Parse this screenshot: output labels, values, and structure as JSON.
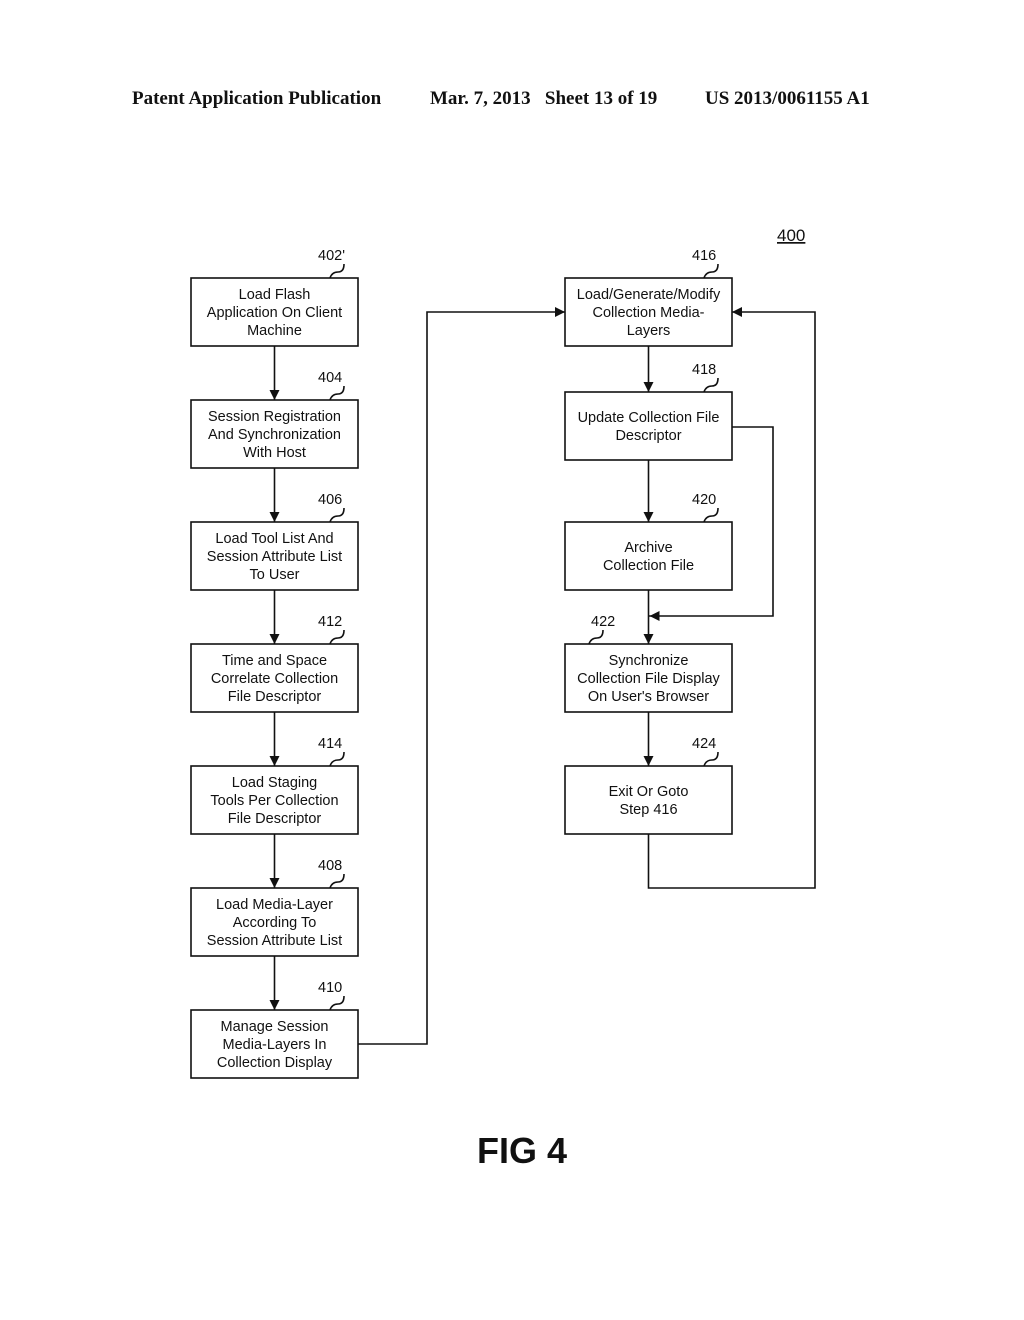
{
  "header": {
    "publication": "Patent Application Publication",
    "date_sheet": "Mar. 7, 2013   Sheet 13 of 19",
    "patent_number": "US 2013/0061155 A1"
  },
  "figure": {
    "reference": "400",
    "label": "FIG 4"
  },
  "steps": [
    {
      "id": "402",
      "ref": "402'",
      "lines": [
        "Load Flash",
        "Application On Client",
        "Machine"
      ]
    },
    {
      "id": "404",
      "ref": "404",
      "lines": [
        "Session Registration",
        "And Synchronization",
        "With Host"
      ]
    },
    {
      "id": "406",
      "ref": "406",
      "lines": [
        "Load Tool List And",
        "Session Attribute List",
        "To User"
      ]
    },
    {
      "id": "412",
      "ref": "412",
      "lines": [
        "Time and Space",
        "Correlate Collection",
        "File Descriptor"
      ]
    },
    {
      "id": "414",
      "ref": "414",
      "lines": [
        "Load Staging",
        "Tools Per Collection",
        "File Descriptor"
      ]
    },
    {
      "id": "408",
      "ref": "408",
      "lines": [
        "Load Media-Layer",
        "According To",
        "Session Attribute List"
      ]
    },
    {
      "id": "410",
      "ref": "410",
      "lines": [
        "Manage Session",
        "Media-Layers In",
        "Collection Display"
      ]
    },
    {
      "id": "416",
      "ref": "416",
      "lines": [
        "Load/Generate/Modify",
        "Collection Media-",
        "Layers"
      ]
    },
    {
      "id": "418",
      "ref": "418",
      "lines": [
        "Update Collection File",
        "Descriptor"
      ]
    },
    {
      "id": "420",
      "ref": "420",
      "lines": [
        "Archive",
        "Collection File"
      ]
    },
    {
      "id": "422",
      "ref": "422",
      "lines": [
        "Synchronize",
        "Collection File Display",
        "On User's Browser"
      ]
    },
    {
      "id": "424",
      "ref": "424",
      "lines": [
        "Exit Or Goto",
        "Step 416"
      ]
    }
  ],
  "connections": [
    {
      "from": "402",
      "to": "404"
    },
    {
      "from": "404",
      "to": "406"
    },
    {
      "from": "406",
      "to": "412"
    },
    {
      "from": "412",
      "to": "414"
    },
    {
      "from": "414",
      "to": "408"
    },
    {
      "from": "408",
      "to": "410"
    },
    {
      "from": "410",
      "to": "416"
    },
    {
      "from": "416",
      "to": "418"
    },
    {
      "from": "418",
      "to": "420"
    },
    {
      "from": "418",
      "to": "422"
    },
    {
      "from": "420",
      "to": "422"
    },
    {
      "from": "422",
      "to": "424"
    },
    {
      "from": "424",
      "to": "416"
    }
  ]
}
